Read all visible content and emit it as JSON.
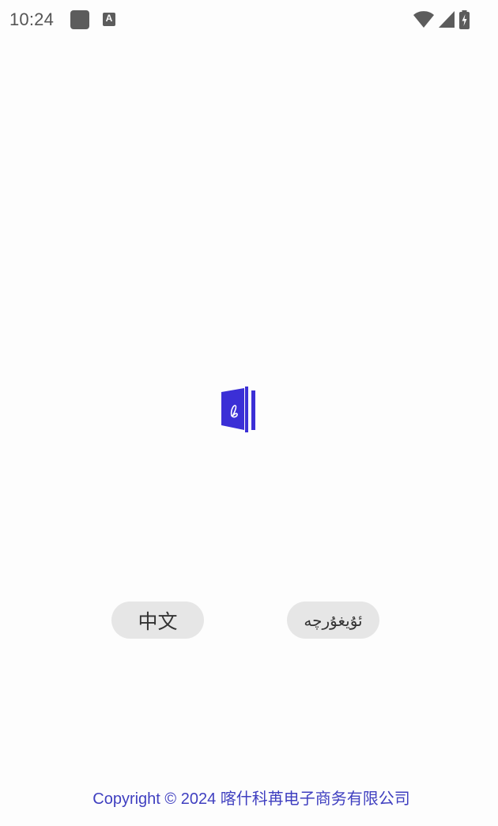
{
  "status_bar": {
    "time": "10:24",
    "notification_icons": [
      "app-notification-icon",
      "a-notification-icon"
    ],
    "notification_a_label": "A",
    "system_icons": [
      "wifi-icon",
      "cellular-signal-icon",
      "battery-charging-icon"
    ]
  },
  "splash": {
    "logo_icon": "book-logo-icon",
    "brand_color": "#3b2fd6"
  },
  "language_buttons": {
    "chinese_label": "中文",
    "uyghur_label": "ئۇيغۇرچە"
  },
  "footer": {
    "copyright": "Copyright © 2024 喀什科苒电子商务有限公司"
  },
  "colors": {
    "accent": "#3b2fd6",
    "copyright_text": "#3f3fc0",
    "button_bg": "#e6e6e6",
    "background": "#fdfdfd"
  }
}
